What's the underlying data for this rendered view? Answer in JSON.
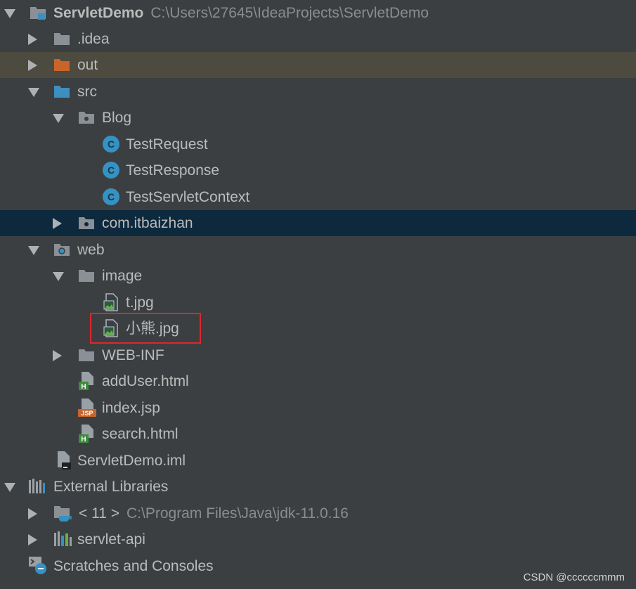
{
  "root": {
    "name": "ServletDemo",
    "path": "C:\\Users\\27645\\IdeaProjects\\ServletDemo"
  },
  "items": {
    "idea": ".idea",
    "out": "out",
    "src": "src",
    "blog": "Blog",
    "test_request": "TestRequest",
    "test_response": "TestResponse",
    "test_servlet_context": "TestServletContext",
    "com_itbaizhan": "com.itbaizhan",
    "web": "web",
    "image": "image",
    "t_jpg": "t.jpg",
    "xiaoxiong_jpg": "小熊.jpg",
    "web_inf": "WEB-INF",
    "add_user_html": "addUser.html",
    "index_jsp": "index.jsp",
    "search_html": "search.html",
    "servletdemo_iml": "ServletDemo.iml",
    "external_libraries": "External Libraries",
    "jdk": {
      "name": "< 11 >",
      "path": "C:\\Program Files\\Java\\jdk-11.0.16"
    },
    "servlet_api": "servlet-api",
    "scratches": "Scratches and Consoles"
  },
  "icon_badges": {
    "class": "C",
    "html": "H",
    "jsp": "JSP"
  },
  "colors": {
    "background": "#3c3f41",
    "selected_row": "#0d293e",
    "out_row": "#4d4a3f",
    "highlight_box": "#e0262a",
    "folder": "#8a9095",
    "source_folder": "#3d8fbf",
    "excluded_folder": "#c9652a"
  },
  "watermark": "CSDN @ccccccmmm"
}
